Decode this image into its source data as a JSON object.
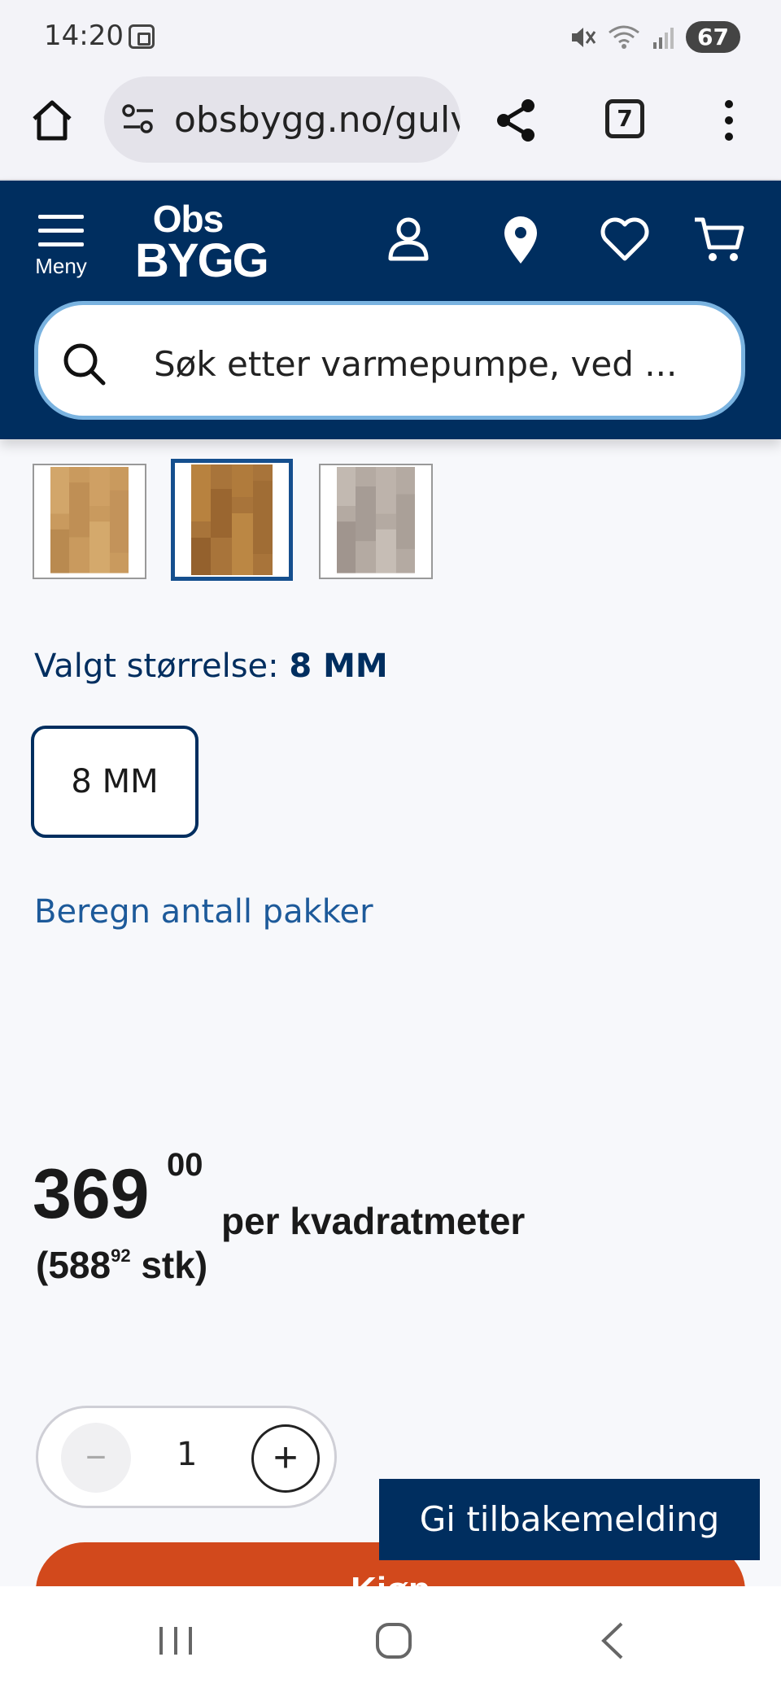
{
  "status_bar": {
    "time": "14:20",
    "battery": "67",
    "icons": [
      "screenshot-icon",
      "mute-icon",
      "wifi-icon",
      "signal-icon",
      "battery-icon"
    ]
  },
  "browser": {
    "url": "obsbygg.no/gulv",
    "tab_count": "7",
    "icons": [
      "home-icon",
      "site-settings-icon",
      "share-icon",
      "tabs-icon",
      "more-icon"
    ]
  },
  "header": {
    "menu_label": "Meny",
    "logo_top": "Obs",
    "logo_bottom": "BYGG",
    "search_placeholder": "Søk etter varmepumpe, ved ...",
    "brand_color": "#002e5f",
    "icons": [
      "menu-icon",
      "account-icon",
      "location-icon",
      "favorites-icon",
      "cart-icon",
      "search-icon"
    ]
  },
  "product": {
    "thumbnails": [
      {
        "name": "light-oak",
        "color": "#c99a5e",
        "selected": false
      },
      {
        "name": "oak",
        "color": "#a8743a",
        "selected": true
      },
      {
        "name": "grey",
        "color": "#b4aaa2",
        "selected": false
      }
    ],
    "size_label_prefix": "Valgt størrelse: ",
    "size_selected": "8 MM",
    "size_options": [
      "8 MM"
    ],
    "calc_link": "Beregn antall pakker",
    "price_whole": "369",
    "price_decimals": "00",
    "price_unit": "per kvadratmeter",
    "package_price_prefix": "(588",
    "package_price_decimals": "92",
    "package_price_suffix": " stk)",
    "quantity": "1",
    "buy_label": "Kjøp",
    "buy_color": "#d2491c"
  },
  "feedback_button": "Gi tilbakemelding",
  "nav": {
    "icons": [
      "recent-apps-icon",
      "home-nav-icon",
      "back-icon"
    ]
  }
}
